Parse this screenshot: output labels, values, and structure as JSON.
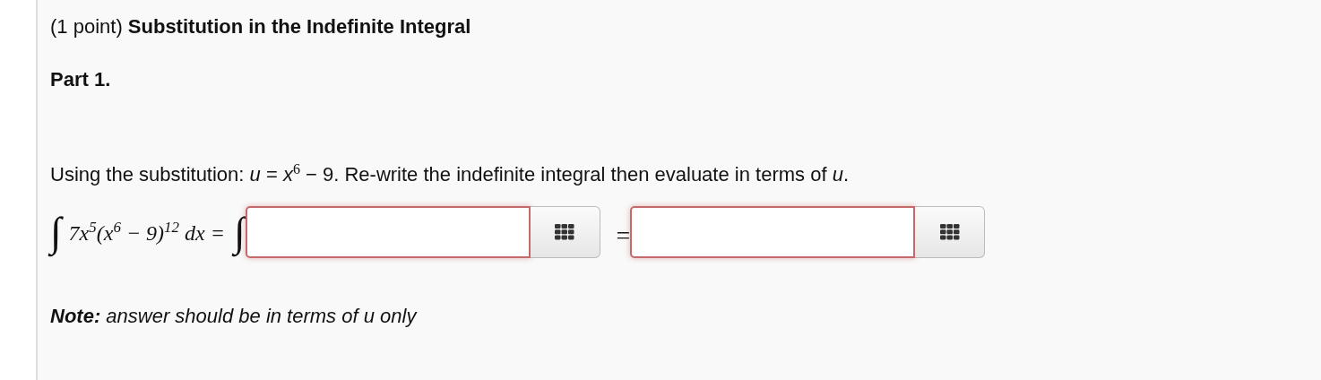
{
  "problem": {
    "header": "(1 point) **Substitution in the Indefinite Integral**",
    "part_title": "Part 1.",
    "instruction": "Using the substitution: *u* = *x*$^{6}$ − 9. Re-write the indefinite integral then evaluate in terms of *u*.",
    "equation": {
      "integral_sign_left": "∫",
      "integrand": "7x$^{5}$(x$^{6}$ − 9)$^{12}$ dx =",
      "integral_sign_right": "∫",
      "equals": "=",
      "answers": [
        {
          "error": true
        },
        {
          "error": true
        }
      ]
    },
    "note": "**Note:** answer should be in terms of *u* only"
  }
}
